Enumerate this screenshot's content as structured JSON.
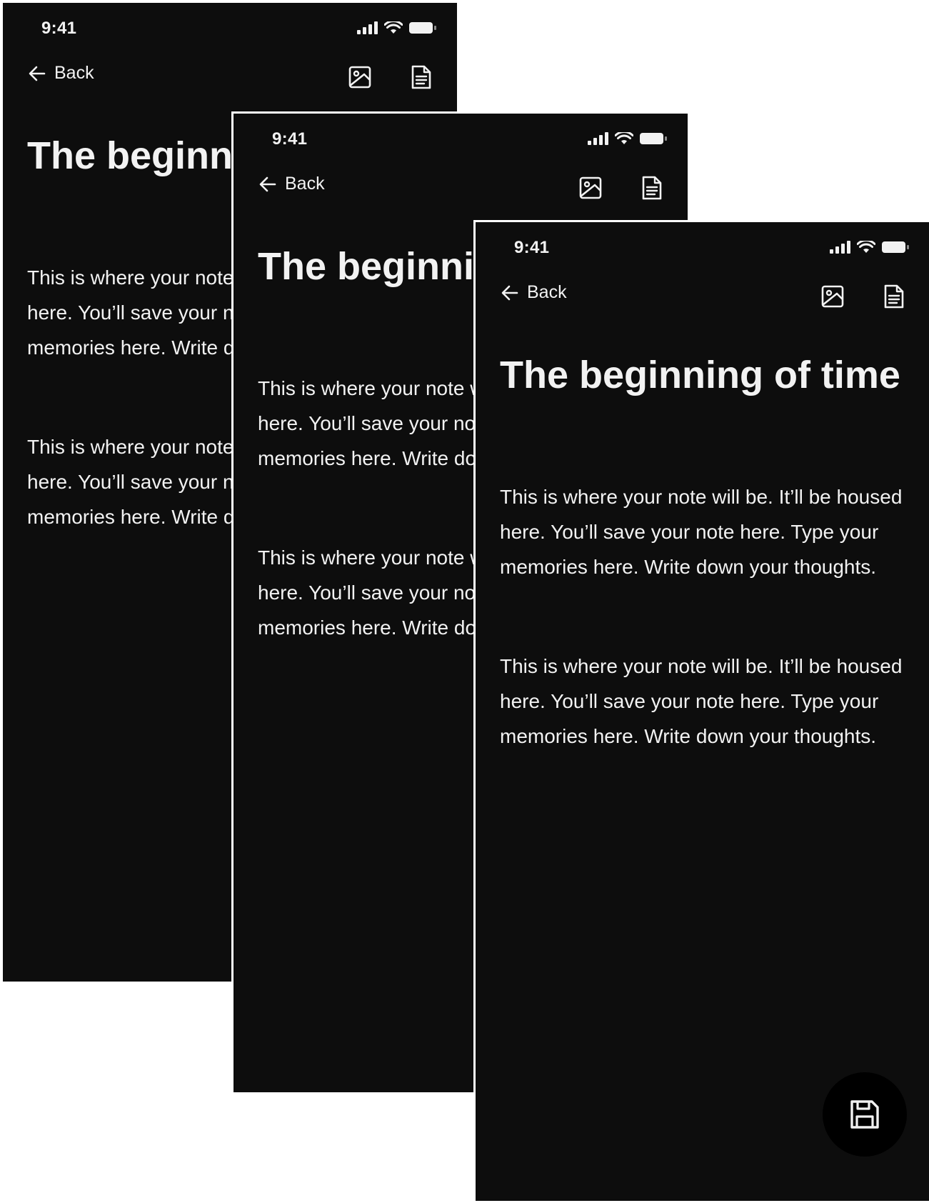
{
  "screens": [
    {
      "status_time": "9:41",
      "back_label": "Back",
      "title": "The beginning of time",
      "paragraphs": [
        "This is where your note will be. It’ll be housed here. You’ll save your note here. Type your memories here. Write down your thoughts.",
        "This is where your note will be. It’ll be housed here. You’ll save your note here. Type your memories here. Write down your thoughts."
      ]
    },
    {
      "status_time": "9:41",
      "back_label": "Back",
      "title": "The beginning of time",
      "paragraphs": [
        "This is where your note will be. It’ll be housed here. You’ll save your note here. Type your memories here. Write down your thoughts.",
        "This is where your note will be. It’ll be housed here. You’ll save your note here. Type your memories here. Write down your thoughts."
      ]
    },
    {
      "status_time": "9:41",
      "back_label": "Back",
      "title": "The beginning of time",
      "paragraphs": [
        "This is where your note will be. It’ll be housed here. You’ll save your note here. Type your memories here. Write down your thoughts.",
        "This is where your note will be. It’ll be housed here. You’ll save your note here. Type your memories here. Write down your thoughts."
      ]
    }
  ],
  "icons": {
    "back": "arrow-left-icon",
    "image": "image-icon",
    "document": "document-icon",
    "save": "save-icon",
    "signal": "signal-icon",
    "wifi": "wifi-icon",
    "battery": "battery-icon"
  },
  "colors": {
    "background": "#0d0d0d",
    "text": "#f2f2f2",
    "fab": "#000000",
    "page": "#ffffff"
  }
}
